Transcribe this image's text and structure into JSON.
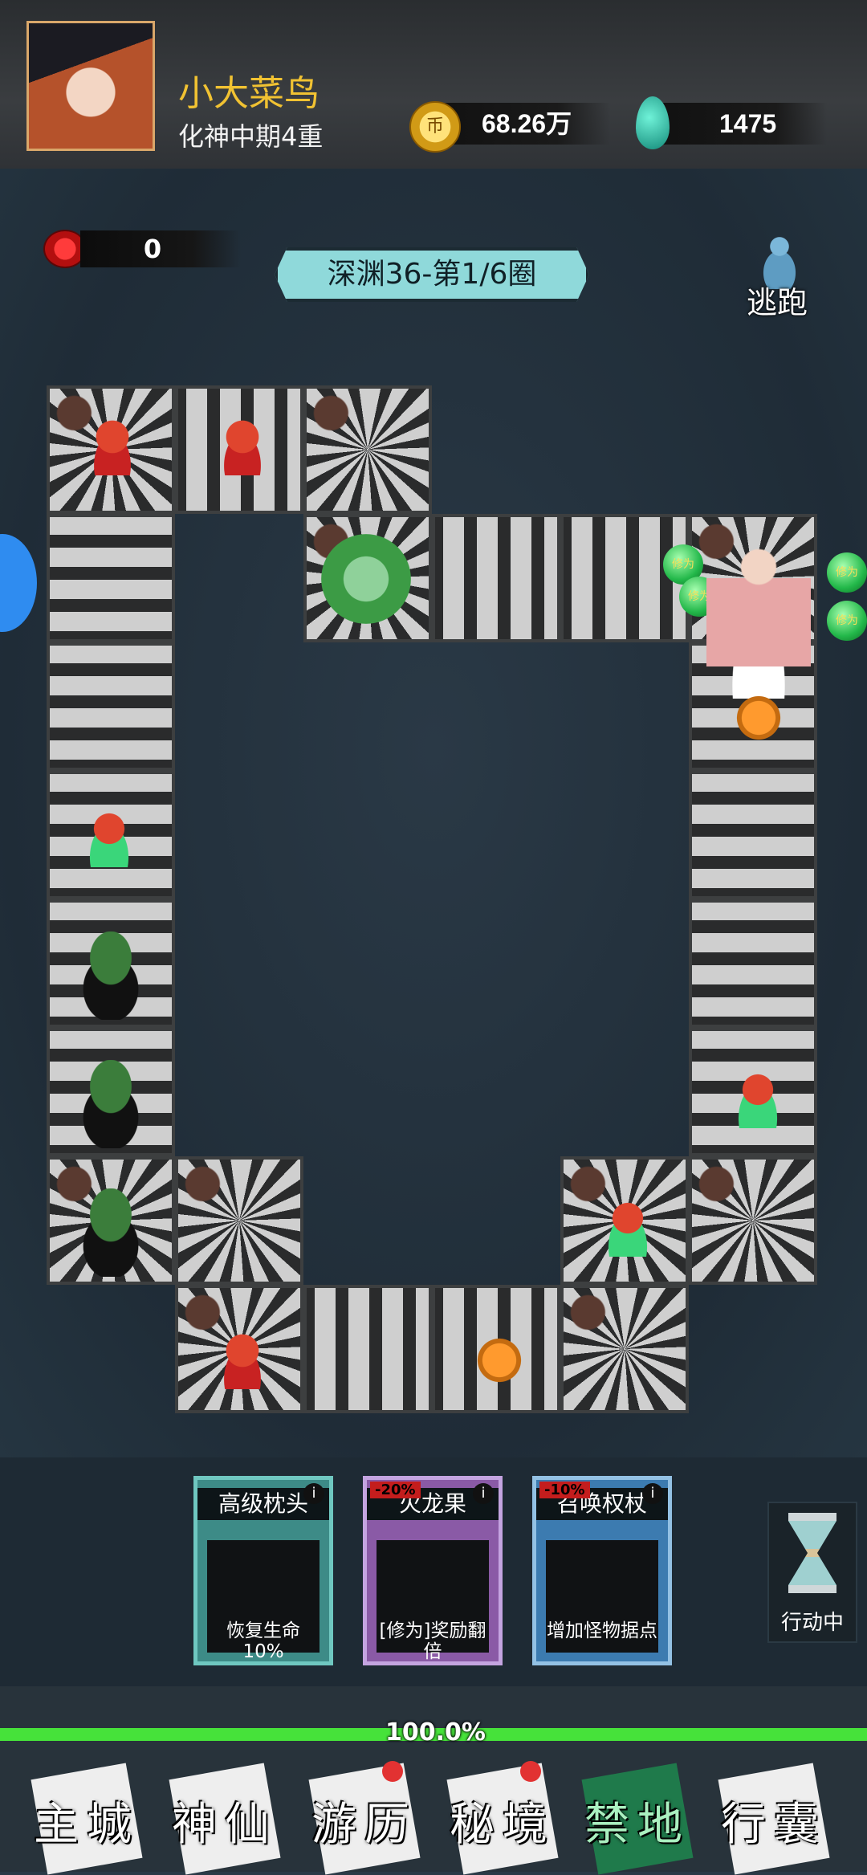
{
  "player": {
    "name": "小大菜鸟",
    "rank": "化神中期4重"
  },
  "currency": {
    "coins": "68.26万",
    "jade": "1475",
    "coin_icon": "coin-icon",
    "jade_icon": "jade-icon"
  },
  "board": {
    "bomb_count": "0",
    "stage": "深渊36-第1/6圈",
    "flee_label": "逃跑",
    "orb_label": "修为"
  },
  "cards": [
    {
      "title": "高级枕头",
      "desc": "恢复生命10%",
      "discount": ""
    },
    {
      "title": "火龙果",
      "desc": "[修为]奖励翻倍",
      "discount": "-20%"
    },
    {
      "title": "召唤权杖",
      "desc": "增加怪物据点",
      "discount": "-10%"
    }
  ],
  "action": {
    "label": "行动中"
  },
  "progress": {
    "text": "100.0%",
    "fraction": 1.0
  },
  "nav": [
    {
      "label": "主城",
      "badge": false
    },
    {
      "label": "神仙",
      "badge": false
    },
    {
      "label": "游历",
      "badge": true
    },
    {
      "label": "秘境",
      "badge": true
    },
    {
      "label": "禁地",
      "badge": false
    },
    {
      "label": "行囊",
      "badge": false
    }
  ]
}
